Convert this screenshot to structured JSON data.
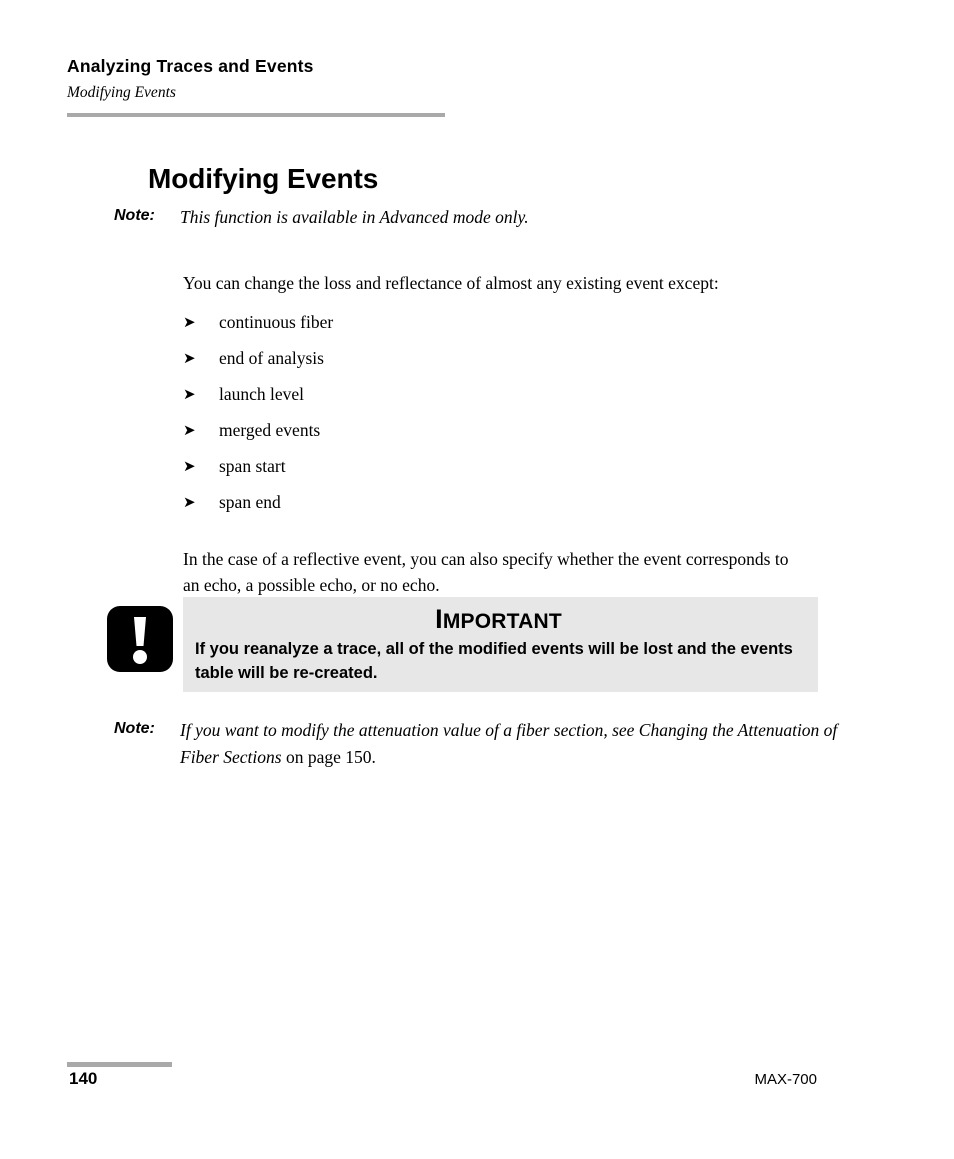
{
  "header": {
    "chapter": "Analyzing Traces and Events",
    "section": "Modifying Events"
  },
  "title": "Modifying Events",
  "notes": {
    "advanced": {
      "label": "Note:",
      "text": "This function is available in Advanced mode only."
    },
    "attenuation": {
      "label": "Note:",
      "text_italic": "If you want to modify the attenuation value of a fiber section, see Changing the Attenuation of Fiber Sections",
      "text_plain": " on page 150."
    }
  },
  "paragraphs": {
    "intro": "You can change the loss and reflectance of almost any existing event except:",
    "reflective": "In the case of a reflective event, you can also specify whether the event corresponds to an echo, a possible echo, or no echo."
  },
  "bullet_marker": "➤",
  "bullets": [
    "continuous fiber",
    "end of analysis",
    "launch level",
    "merged events",
    "span start",
    "span end"
  ],
  "callout": {
    "title_cap": "I",
    "title_rest": "MPORTANT",
    "body": "If you reanalyze a trace, all of the modified events will be lost and the events table will be re-created.",
    "background": "#e7e7e7",
    "icon_color": "#000000"
  },
  "footer": {
    "page_number": "140",
    "product": "MAX-700",
    "rule_color": "#a9a9a9"
  }
}
